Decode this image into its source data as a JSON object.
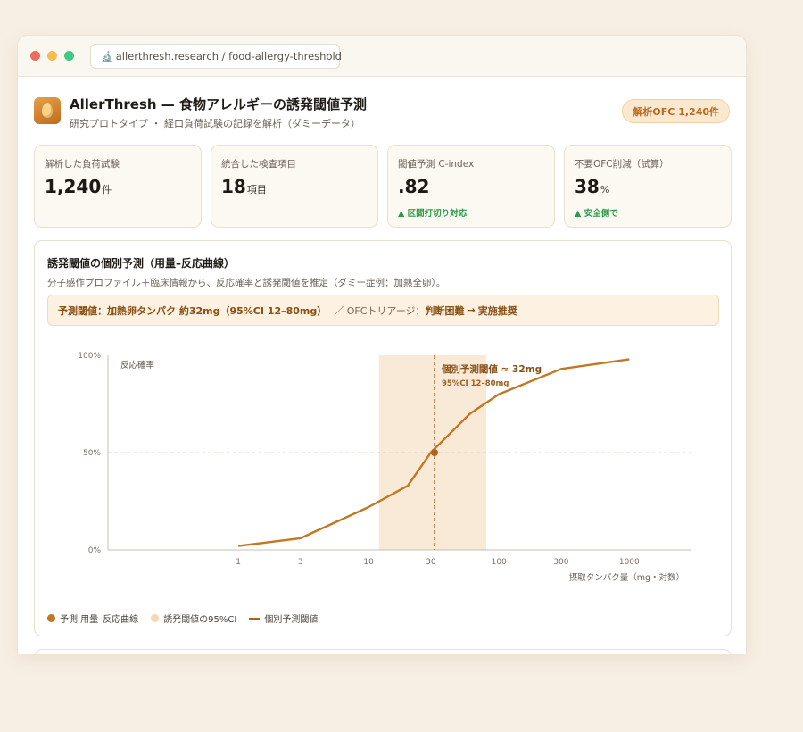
{
  "browser": {
    "url": "allerthresh.research / food-allergy-threshold",
    "url_icon": "microscope-icon"
  },
  "header": {
    "title": "AllerThresh — 食物アレルギーの誘発閾値予測",
    "subtitle": "研究プロトタイプ ・ 経口負荷試験の記録を解析（ダミーデータ）",
    "badge": "解析OFC 1,240件"
  },
  "stats": [
    {
      "label": "解析した負荷試験",
      "value": "1,240",
      "unit": "件",
      "note": ""
    },
    {
      "label": "統合した検査項目",
      "value": "18",
      "unit": "項目",
      "note": ""
    },
    {
      "label": "閾値予測 C-index",
      "value": ".82",
      "unit": "",
      "note": "▲ 区間打切り対応"
    },
    {
      "label": "不要OFC削減（試算）",
      "value": "38",
      "unit": "%",
      "note": "▲ 安全側で"
    }
  ],
  "chart_card": {
    "title": "誘発閾値の個別予測（用量–反応曲線）",
    "subtitle": "分子感作プロファイル＋臨床情報から、反応確率と誘発閾値を推定（ダミー症例：加熱全卵）。",
    "banner": {
      "prediction": "予測閾値：加熱卵タンパク 約32mg（95%CI 12–80mg）",
      "triage_label": "／ OFCトリアージ：",
      "triage_from": "判断困難",
      "arrow": "→",
      "triage_to": "実施推奨"
    },
    "legend": [
      "予測 用量–反応曲線",
      "誘発閾値の95%CI",
      "個別予測閾値"
    ]
  },
  "chart_data": {
    "type": "line",
    "title": "",
    "xlabel": "摂取タンパク量（mg・対数）",
    "ylabel": "反応確率",
    "x_scale": "log",
    "x_ticks": [
      1,
      3,
      10,
      30,
      100,
      300,
      1000
    ],
    "y_ticks": [
      0,
      50,
      100
    ],
    "y_tick_labels": [
      "0%",
      "50%",
      "100%"
    ],
    "xlim": [
      0.1,
      3000
    ],
    "ylim": [
      0,
      100
    ],
    "series": [
      {
        "name": "予測 用量–反応曲線",
        "x": [
          1,
          3,
          10,
          20,
          30,
          60,
          100,
          300,
          1000
        ],
        "y": [
          2,
          6,
          22,
          33,
          50,
          70,
          80,
          93,
          98
        ]
      }
    ],
    "ci_band": {
      "name": "誘発閾値の95%CI",
      "low": 12,
      "high": 80
    },
    "threshold": {
      "name": "個別予測閾値",
      "x": 32,
      "y": 50
    },
    "reference_line_y": 50,
    "annotation": {
      "text": "個別予測閾値 ≈ 32mg",
      "subtext": "95%CI 12–80mg"
    },
    "grid": false,
    "legend_position": "bottom-left",
    "colors": {
      "line": "#c47722",
      "band": "#f8ead7",
      "threshold": "#b3601a",
      "axis": "#c8bfb4",
      "ref": "#e3d4c1"
    }
  }
}
